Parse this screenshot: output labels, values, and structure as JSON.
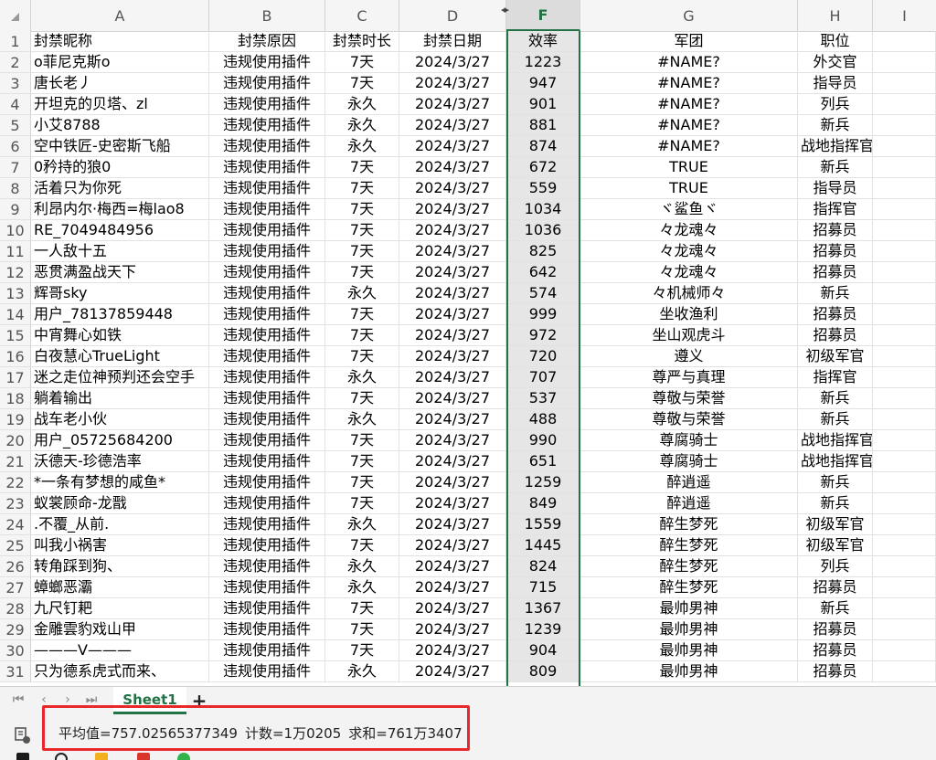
{
  "columns": [
    "A",
    "B",
    "C",
    "D",
    "F",
    "G",
    "H",
    "I"
  ],
  "selected_column": "F",
  "rows": [
    {
      "n": "1",
      "a": "封禁昵称",
      "b": "封禁原因",
      "c": "封禁时长",
      "d": "封禁日期",
      "f": "效率",
      "g": "军团",
      "h": "职位"
    },
    {
      "n": "2",
      "a": "o菲尼克斯o",
      "b": "违规使用插件",
      "c": "7天",
      "d": "2024/3/27",
      "f": "1223",
      "g": "#NAME?",
      "h": "外交官"
    },
    {
      "n": "3",
      "a": "唐长老丿",
      "b": "违规使用插件",
      "c": "7天",
      "d": "2024/3/27",
      "f": "947",
      "g": "#NAME?",
      "h": "指导员"
    },
    {
      "n": "4",
      "a": "开坦克的贝塔、zl",
      "b": "违规使用插件",
      "c": "永久",
      "d": "2024/3/27",
      "f": "901",
      "g": "#NAME?",
      "h": "列兵"
    },
    {
      "n": "5",
      "a": "小艾8788",
      "b": "违规使用插件",
      "c": "永久",
      "d": "2024/3/27",
      "f": "881",
      "g": "#NAME?",
      "h": "新兵"
    },
    {
      "n": "6",
      "a": "空中铁匠-史密斯飞船",
      "b": "违规使用插件",
      "c": "永久",
      "d": "2024/3/27",
      "f": "874",
      "g": "#NAME?",
      "h": "战地指挥官"
    },
    {
      "n": "7",
      "a": "0矜持的狼0",
      "b": "违规使用插件",
      "c": "7天",
      "d": "2024/3/27",
      "f": "672",
      "g": "TRUE",
      "h": "新兵"
    },
    {
      "n": "8",
      "a": "活着只为你死",
      "b": "违规使用插件",
      "c": "7天",
      "d": "2024/3/27",
      "f": "559",
      "g": "TRUE",
      "h": "指导员"
    },
    {
      "n": "9",
      "a": "利昂内尔·梅西=梅lao8",
      "b": "违规使用插件",
      "c": "7天",
      "d": "2024/3/27",
      "f": "1034",
      "g": "ヾ鲨鱼ヾ",
      "h": "指挥官"
    },
    {
      "n": "10",
      "a": "RE_7049484956",
      "b": "违规使用插件",
      "c": "7天",
      "d": "2024/3/27",
      "f": "1036",
      "g": "々龙魂々",
      "h": "招募员"
    },
    {
      "n": "11",
      "a": "一人敌十五",
      "b": "违规使用插件",
      "c": "7天",
      "d": "2024/3/27",
      "f": "825",
      "g": "々龙魂々",
      "h": "招募员"
    },
    {
      "n": "12",
      "a": "恶贯满盈战天下",
      "b": "违规使用插件",
      "c": "7天",
      "d": "2024/3/27",
      "f": "642",
      "g": "々龙魂々",
      "h": "招募员"
    },
    {
      "n": "13",
      "a": "辉哥sky",
      "b": "违规使用插件",
      "c": "永久",
      "d": "2024/3/27",
      "f": "574",
      "g": "々机械师々",
      "h": "新兵"
    },
    {
      "n": "14",
      "a": "用户_78137859448",
      "b": "违规使用插件",
      "c": "7天",
      "d": "2024/3/27",
      "f": "999",
      "g": "坐收渔利",
      "h": "招募员"
    },
    {
      "n": "15",
      "a": "中宵舞心如铁",
      "b": "违规使用插件",
      "c": "7天",
      "d": "2024/3/27",
      "f": "972",
      "g": "坐山观虎斗",
      "h": "招募员"
    },
    {
      "n": "16",
      "a": "白夜慧心TrueLight",
      "b": "违规使用插件",
      "c": "7天",
      "d": "2024/3/27",
      "f": "720",
      "g": "遵义",
      "h": "初级军官"
    },
    {
      "n": "17",
      "a": "迷之走位神预判还会空手",
      "b": "违规使用插件",
      "c": "永久",
      "d": "2024/3/27",
      "f": "707",
      "g": "尊严与真理",
      "h": "指挥官"
    },
    {
      "n": "18",
      "a": "躺着输出",
      "b": "违规使用插件",
      "c": "7天",
      "d": "2024/3/27",
      "f": "537",
      "g": "尊敬与荣誉",
      "h": "新兵"
    },
    {
      "n": "19",
      "a": "战车老小伙",
      "b": "违规使用插件",
      "c": "永久",
      "d": "2024/3/27",
      "f": "488",
      "g": "尊敬与荣誉",
      "h": "新兵"
    },
    {
      "n": "20",
      "a": "用户_05725684200",
      "b": "违规使用插件",
      "c": "7天",
      "d": "2024/3/27",
      "f": "990",
      "g": "尊腐骑士",
      "h": "战地指挥官"
    },
    {
      "n": "21",
      "a": "沃德天-珍德浩率",
      "b": "违规使用插件",
      "c": "7天",
      "d": "2024/3/27",
      "f": "651",
      "g": "尊腐骑士",
      "h": "战地指挥官"
    },
    {
      "n": "22",
      "a": "*一条有梦想的咸鱼*",
      "b": "违规使用插件",
      "c": "7天",
      "d": "2024/3/27",
      "f": "1259",
      "g": "醉逍遥",
      "h": "新兵"
    },
    {
      "n": "23",
      "a": "蚁裳顾命-龙戬",
      "b": "违规使用插件",
      "c": "7天",
      "d": "2024/3/27",
      "f": "849",
      "g": "醉逍遥",
      "h": "新兵"
    },
    {
      "n": "24",
      "a": ".不覆_从前.",
      "b": "违规使用插件",
      "c": "永久",
      "d": "2024/3/27",
      "f": "1559",
      "g": "醉生梦死",
      "h": "初级军官"
    },
    {
      "n": "25",
      "a": "叫我小祸害",
      "b": "违规使用插件",
      "c": "7天",
      "d": "2024/3/27",
      "f": "1445",
      "g": "醉生梦死",
      "h": "初级军官"
    },
    {
      "n": "26",
      "a": "转角踩到狗、",
      "b": "违规使用插件",
      "c": "永久",
      "d": "2024/3/27",
      "f": "824",
      "g": "醉生梦死",
      "h": "列兵"
    },
    {
      "n": "27",
      "a": "蟑螂恶灞",
      "b": "违规使用插件",
      "c": "永久",
      "d": "2024/3/27",
      "f": "715",
      "g": "醉生梦死",
      "h": "招募员"
    },
    {
      "n": "28",
      "a": "九尺钉耙",
      "b": "违规使用插件",
      "c": "7天",
      "d": "2024/3/27",
      "f": "1367",
      "g": "最帅男神",
      "h": "新兵"
    },
    {
      "n": "29",
      "a": "金雕雲豹戏山甲",
      "b": "违规使用插件",
      "c": "7天",
      "d": "2024/3/27",
      "f": "1239",
      "g": "最帅男神",
      "h": "招募员"
    },
    {
      "n": "30",
      "a": "———V———",
      "b": "违规使用插件",
      "c": "7天",
      "d": "2024/3/27",
      "f": "904",
      "g": "最帅男神",
      "h": "招募员"
    },
    {
      "n": "31",
      "a": "只为德系虎式而来、",
      "b": "违规使用插件",
      "c": "永久",
      "d": "2024/3/27",
      "f": "809",
      "g": "最帅男神",
      "h": "招募员"
    }
  ],
  "sheet_tabs": [
    "Sheet1"
  ],
  "status": {
    "average": "平均值=757.02565377349",
    "count": "计数=1万0205",
    "sum": "求和=761万3407"
  },
  "colors": {
    "accent": "#217346",
    "highlight_box": "#e8282a",
    "selected_column_bg": "#e6e6e6"
  }
}
